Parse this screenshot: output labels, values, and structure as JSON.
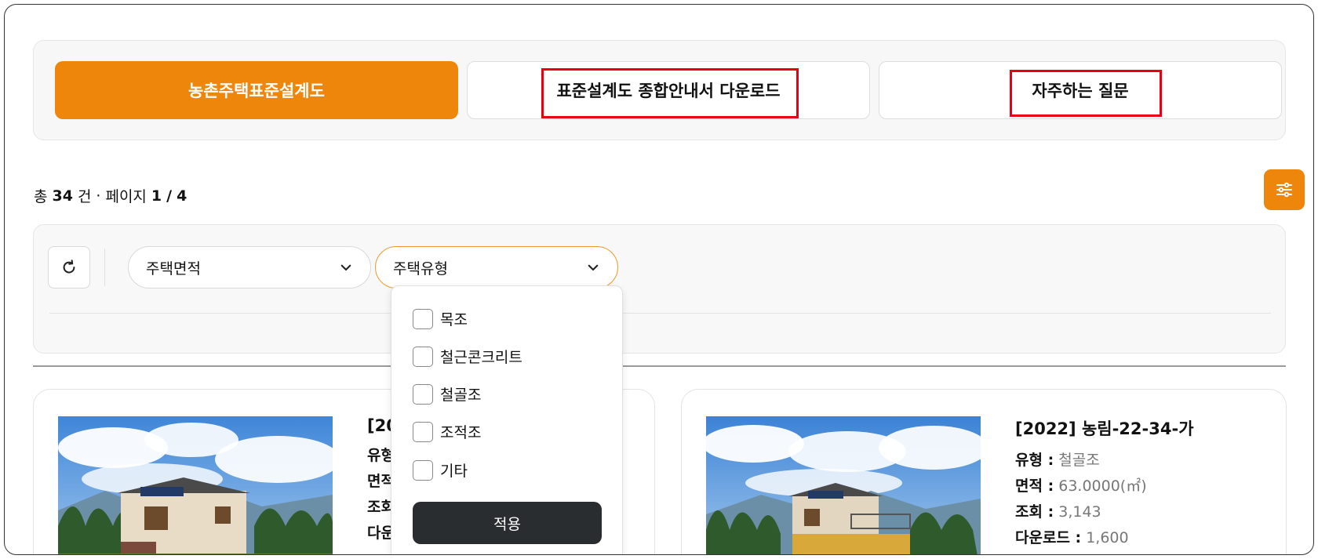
{
  "tabs": {
    "active_label": "농촌주택표준설계도",
    "guide_label": "표준설계도 종합안내서 다운로드",
    "faq_label": "자주하는 질문"
  },
  "summary": {
    "prefix": "총",
    "total": "34",
    "unit": "건",
    "sep": "·",
    "page_label": "페이지",
    "page_current": "1",
    "page_sep": "/",
    "page_total": "4"
  },
  "filters": {
    "area_label": "주택면적",
    "type_label": "주택유형"
  },
  "dropdown": {
    "options": [
      "목조",
      "철근콘크리트",
      "철골조",
      "조적조",
      "기타"
    ],
    "apply_label": "적용"
  },
  "cards": [
    {
      "title": "[20",
      "type_label": "유형",
      "area_label": "면적",
      "views_label": "조회",
      "downloads_label": "다운"
    },
    {
      "title": "[2022] 농림-22-34-가",
      "type_label": "유형 :",
      "type_value": "철골조",
      "area_label": "면적 :",
      "area_value": "63.0000(㎡)",
      "views_label": "조회 :",
      "views_value": "3,143",
      "downloads_label": "다운로드 :",
      "downloads_value": "1,600"
    }
  ],
  "colors": {
    "accent": "#ee860b",
    "highlight": "#e60012",
    "apply_bg": "#2a2d30"
  }
}
